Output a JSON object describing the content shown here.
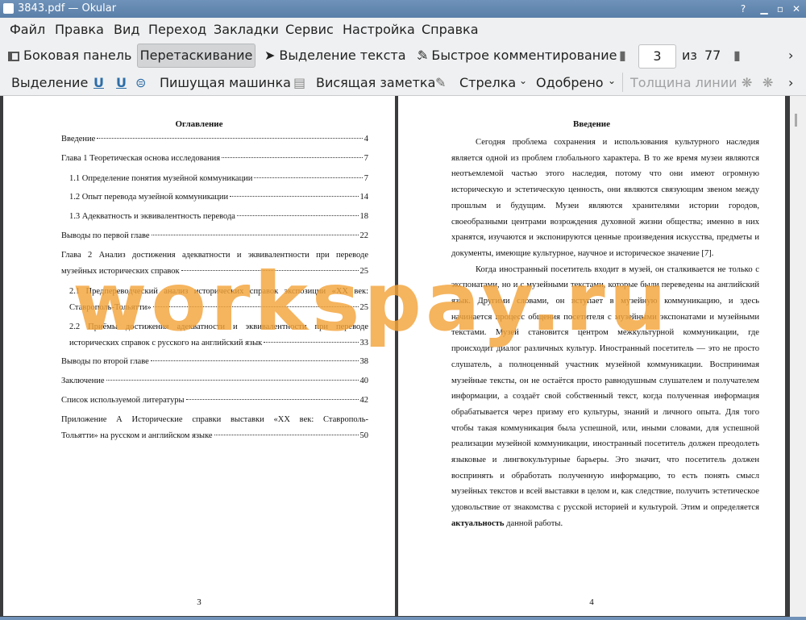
{
  "window": {
    "title": "3843.pdf  — Okular"
  },
  "menu": [
    "Файл",
    "Правка",
    "Вид",
    "Переход",
    "Закладки",
    "Сервис",
    "Настройка",
    "Справка"
  ],
  "toolbar1": {
    "sidebar": "Боковая панель",
    "drag": "Перетаскивание",
    "select_text": "Выделение текста",
    "quick_comment": "Быстрое комментирование",
    "page_current": "3",
    "page_of": "из",
    "page_total": "77"
  },
  "toolbar2": {
    "selection": "Выделение",
    "typewriter": "Пишущая машинка",
    "hanging_note": "Висящая заметка",
    "arrow": "Стрелка",
    "approved": "Одобрено",
    "line_width": "Толщина линии"
  },
  "page1": {
    "title": "Оглавление",
    "toc": [
      {
        "text": "Введение",
        "page": "4"
      },
      {
        "text": "Глава 1 Теоретическая основа исследования",
        "page": "7"
      },
      {
        "text": "1.1 Определение понятия музейной коммуникации",
        "page": "7"
      },
      {
        "text": "1.2 Опыт перевода музейной коммуникации",
        "page": "14"
      },
      {
        "text": "1.3 Адекватность и эквивалентность перевода",
        "page": "18"
      },
      {
        "text": "Выводы по первой главе",
        "page": "22"
      },
      {
        "text": "Глава 2 Анализ достижения адекватности и эквивалентности при переводе",
        "text2": "музейных исторических справок",
        "page": "25"
      },
      {
        "text": "2.1 Предпереводческий анализ исторических справок экспозиции «ХХ век:",
        "text2": "Ставрополь-Тольятти»",
        "page": "25"
      },
      {
        "text": "2.2 Приёмы достижения адекватности и эквивалентности при переводе",
        "text2": "исторических справок с русского на английский язык",
        "page": "33"
      },
      {
        "text": "Выводы по второй главе",
        "page": "38"
      },
      {
        "text": "Заключение",
        "page": "40"
      },
      {
        "text": "Список используемой литературы",
        "page": "42"
      },
      {
        "text": "Приложение А Исторические справки выставки «ХХ век: Ставрополь-",
        "text2": "Тольятти» на русском и английском языке",
        "page": "50"
      }
    ],
    "page_number": "3"
  },
  "page2": {
    "title": "Введение",
    "para1": "Сегодня проблема сохранения и использования культурного наследия является одной из проблем глобального характера. В то же время музеи являются неотъемлемой частью этого наследия, потому что они имеют огромную историческую и эстетическую ценность, они являются связующим звеном между прошлым и будущим. Музеи являются хранителями истории городов, своеобразными центрами возрождения духовной жизни общества; именно в них хранятся, изучаются и экспонируются ценные произведения искусства, предметы и документы, имеющие культурное, научное и историческое значение [7].",
    "para2": "Когда иностранный посетитель входит в музей, он сталкивается не только с экспонатами, но и с музейными текстами, которые были переведены на английский язык. Другими словами, он вступает в музейную коммуникацию, и здесь начинается процесс общения посетителя с музейными экспонатами и музейными текстами. Музей становится центром межкультурной коммуникации, где происходит диалог различных культур. Иностранный посетитель — это не просто слушатель, а полноценный участник музейной коммуникации. Воспринимая музейные тексты, он не остаётся просто равнодушным слушателем и получателем информации, а создаёт свой собственный текст, когда полученная информация обрабатывается через призму его культуры, знаний и личного опыта. Для того чтобы такая коммуникация была успешной, или, иными словами, для успешной реализации музейной коммуникации, иностранный посетитель должен преодолеть языковые и лингвокультурные барьеры. Это значит, что посетитель должен воспринять и обработать полученную информацию, то есть понять смысл музейных текстов и всей выставки в целом и, как следствие, получить эстетическое удовольствие от знакомства с русской историей и культурой. Этим и определяется",
    "para2_bold": "актуальность",
    "para2_end": " данной работы.",
    "page_number": "4"
  },
  "watermark": "workspay.ru"
}
